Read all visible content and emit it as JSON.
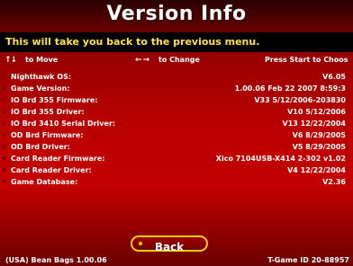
{
  "title": "Version Info",
  "message": "This will take you back to the previous menu.",
  "hints": {
    "move_icon": "up-down-arrows-icon",
    "move_arrows": "↑↓",
    "move": "to Move",
    "change_icon": "left-right-arrows-icon",
    "change_arrows": "← →",
    "change": "to Change",
    "start": "Press Start to Choos"
  },
  "rows": [
    {
      "label": "Nighthawk OS:",
      "value": "V6.05"
    },
    {
      "label": "Game Version:",
      "value": "1.00.06 Feb 22 2007 8:59:3"
    },
    {
      "label": "IO Brd 355 Firmware:",
      "value": "V33 5/12/2006-203830"
    },
    {
      "label": "IO Brd 355 Driver:",
      "value": "V10 5/12/2006"
    },
    {
      "label": "IO Brd 3410 Serial Driver:",
      "value": "V13 12/22/2004"
    },
    {
      "label": "OD Brd Firmware:",
      "value": "V6 8/29/2005"
    },
    {
      "label": "OD Brd Driver:",
      "value": "V5 8/29/2005"
    },
    {
      "label": "Card Reader Firmware:",
      "value": "Xico 7104USB-X414 2-302 v1.02"
    },
    {
      "label": "Card Reader Driver:",
      "value": "V4 12/22/2004"
    },
    {
      "label": "Game Database:",
      "value": "V2.36"
    }
  ],
  "back_label": "Back",
  "footer": {
    "left": "(USA) Bean Bags 1.00.06",
    "right": "T-Game ID 20-88957"
  },
  "colors": {
    "background": "#b80000",
    "message_text": "#ffe24a",
    "button_border": "#ffd000"
  }
}
